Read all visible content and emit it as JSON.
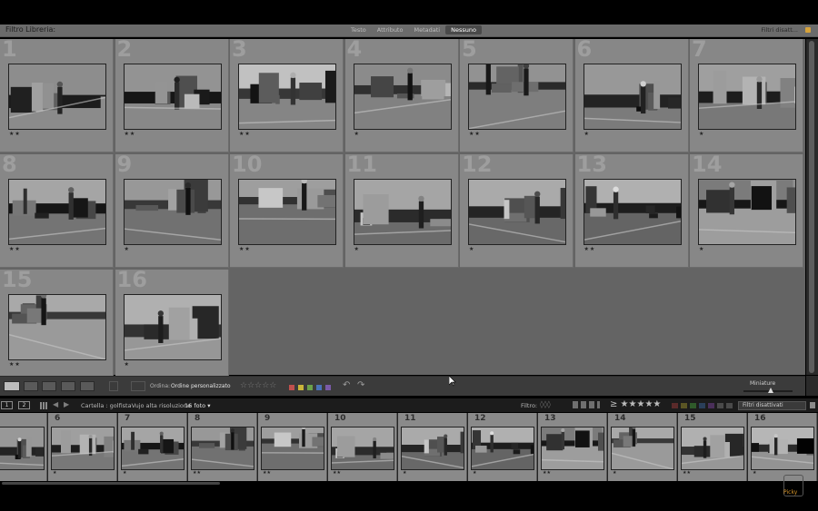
{
  "filter_bar": {
    "title": "Filtro Libreria:",
    "tabs": [
      "Testo",
      "Attributo",
      "Metadati",
      "Nessuno"
    ],
    "active_tab": "Nessuno",
    "filters_status": "Filtri disatt...",
    "lock_icon": "lock-icon"
  },
  "grid": {
    "photos": [
      {
        "index": "1",
        "rating": "★★"
      },
      {
        "index": "2",
        "rating": "★★"
      },
      {
        "index": "3",
        "rating": "★★"
      },
      {
        "index": "4",
        "rating": "★"
      },
      {
        "index": "5",
        "rating": "★★"
      },
      {
        "index": "6",
        "rating": "★"
      },
      {
        "index": "7",
        "rating": "★"
      },
      {
        "index": "8",
        "rating": "★★"
      },
      {
        "index": "9",
        "rating": "★"
      },
      {
        "index": "10",
        "rating": "★★"
      },
      {
        "index": "11",
        "rating": "★"
      },
      {
        "index": "12",
        "rating": "★"
      },
      {
        "index": "13",
        "rating": "★★"
      },
      {
        "index": "14",
        "rating": "★"
      },
      {
        "index": "15",
        "rating": "★★"
      },
      {
        "index": "16",
        "rating": "★"
      }
    ]
  },
  "toolbar": {
    "sort_label": "Ordina:",
    "sort_value": "Ordine personalizzato",
    "rating_stars": "☆☆☆☆☆",
    "thumbnails_label": "Miniature",
    "thumbnail_size": 0.55,
    "color_labels": [
      "#c0504d",
      "#c9b53a",
      "#6aa14a",
      "#4a72b8",
      "#7a5aa8"
    ]
  },
  "filmstrip_header": {
    "view1": "1",
    "view2": "2",
    "source": "Cartella : golfistaVujo alta risoluzione",
    "count": "16 foto",
    "filter_label": "Filtro:",
    "rating_filter": "≥ ★★★★★",
    "filter_select": "Filtri disattivati",
    "swatch_colors": [
      "#5a2a2a",
      "#5a5524",
      "#2f5a2a",
      "#2a3f5a",
      "#4a2f5a",
      "#4a4a4a",
      "#4a4a4a"
    ]
  },
  "filmstrip": {
    "items": [
      {
        "index": "",
        "rating": "★"
      },
      {
        "index": "6",
        "rating": "★"
      },
      {
        "index": "7",
        "rating": "★"
      },
      {
        "index": "8",
        "rating": "★★"
      },
      {
        "index": "9",
        "rating": "★★"
      },
      {
        "index": "10",
        "rating": "★★"
      },
      {
        "index": "11",
        "rating": "★"
      },
      {
        "index": "12",
        "rating": "★"
      },
      {
        "index": "13",
        "rating": "★★"
      },
      {
        "index": "14",
        "rating": "★"
      },
      {
        "index": "15",
        "rating": "★★"
      },
      {
        "index": "16",
        "rating": "★"
      }
    ]
  },
  "watermark": {
    "text": "Picky"
  }
}
